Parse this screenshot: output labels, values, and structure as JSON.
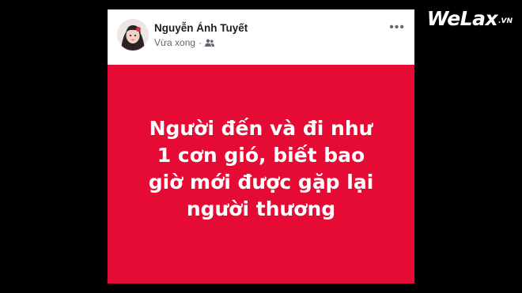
{
  "watermark": {
    "brand": "WeLax",
    "tld": ".VN"
  },
  "post": {
    "author": "Nguyễn Ánh Tuyết",
    "timestamp": "Vừa xong",
    "separator": "·",
    "audience_icon": "friends-icon",
    "more_icon": "more-horizontal-icon",
    "more_label": "•••",
    "text": "Người đến và đi như 1 cơn gió, biết bao giờ mới được gặp lại người thương",
    "background_color": "#e60b35",
    "text_color": "#ffffff"
  }
}
